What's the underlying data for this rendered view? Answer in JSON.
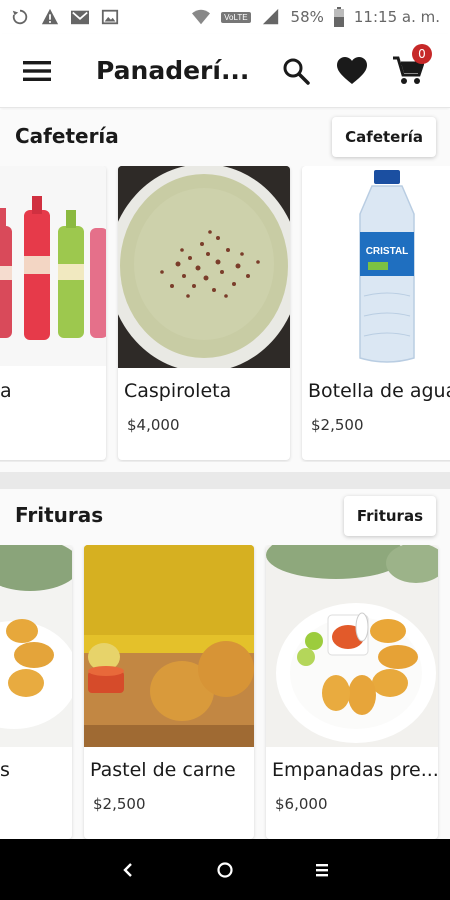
{
  "status_bar": {
    "battery": "58%",
    "time": "11:15 a. m.",
    "volte": "VoLTE"
  },
  "app_bar": {
    "title": "Panaderí...",
    "cart_count": "0",
    "icons": [
      "menu-icon",
      "search-icon",
      "heart-icon",
      "cart-icon"
    ]
  },
  "sections": [
    {
      "title": "Cafetería",
      "button": "Cafetería",
      "products": [
        {
          "name": "a",
          "price": "",
          "image": "soda-bottles"
        },
        {
          "name": "Caspiroleta",
          "price": "$4,000",
          "image": "caspiroleta-bowl"
        },
        {
          "name": "Botella de agua",
          "price": "$2,500",
          "image": "water-bottle"
        }
      ]
    },
    {
      "title": "Frituras",
      "button": "Frituras",
      "products": [
        {
          "name": "s",
          "price": "",
          "image": "fried-snacks"
        },
        {
          "name": "Pastel de carne",
          "price": "$2,500",
          "image": "pastel-de-carne"
        },
        {
          "name": "Empanadas pre...",
          "price": "$6,000",
          "image": "empanadas-plate"
        }
      ]
    }
  ],
  "nav_bar": {
    "icons": [
      "back-icon",
      "home-icon",
      "recents-icon"
    ]
  },
  "colors": {
    "badge": "#c62828",
    "divider": "#e9e9e9",
    "nav_bar": "#000000"
  }
}
